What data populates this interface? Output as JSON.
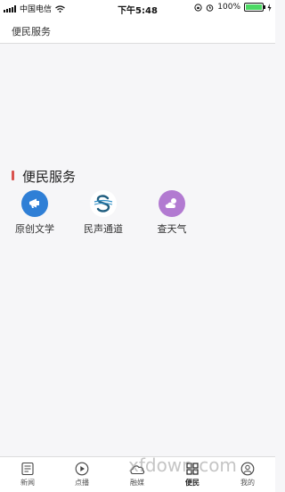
{
  "status_bar": {
    "carrier": "中国电信",
    "time": "下午5:48",
    "battery": "100%"
  },
  "header": {
    "title": "便民服务"
  },
  "section": {
    "title": "便民服务",
    "accent_color": "#d9534f"
  },
  "services": [
    {
      "label": "原创文学",
      "icon": "megaphone-icon",
      "color": "#2f7fd6"
    },
    {
      "label": "民声通道",
      "icon": "s-logo-icon",
      "color": "#2d6f8f"
    },
    {
      "label": "查天气",
      "icon": "weather-icon",
      "color": "#b27ad1"
    }
  ],
  "tabs": [
    {
      "label": "新闻",
      "icon": "news-icon"
    },
    {
      "label": "点播",
      "icon": "play-icon"
    },
    {
      "label": "融媒",
      "icon": "cloud-icon"
    },
    {
      "label": "便民",
      "icon": "grid-icon",
      "active": true
    },
    {
      "label": "我的",
      "icon": "user-icon"
    }
  ],
  "watermark": "xfdown.com"
}
